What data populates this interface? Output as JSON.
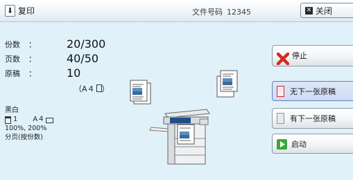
{
  "header": {
    "title": "复印",
    "doc_number_label": "文件号码",
    "doc_number_value": "12345",
    "close_label": "关闭"
  },
  "job": {
    "copies_label": "份数",
    "copies_value": "20/300",
    "pages_label": "页数",
    "pages_value": "40/50",
    "originals_label": "原稿",
    "originals_value": "10",
    "originals_size": "（A４",
    "originals_size_end": "）",
    "color_mode": "黑白",
    "tray_qty": "1",
    "paper_size": "A４",
    "reduce_enlarge": "100%, 200%",
    "collation": "分页(按份数)"
  },
  "actions": {
    "stop_label": "停止",
    "no_next_label": "无下一张原稿",
    "next_label": "有下一张原稿",
    "start_label": "启动"
  },
  "colors": {
    "panel_background": "#e0f1fa",
    "stop_icon": "#d42a1e",
    "start_icon": "#3aa83a",
    "selected_border": "#dd2222"
  },
  "icons": {
    "title": "copy-icon",
    "close": "close-icon",
    "stop": "stop-x-icon",
    "start": "start-play-icon"
  }
}
